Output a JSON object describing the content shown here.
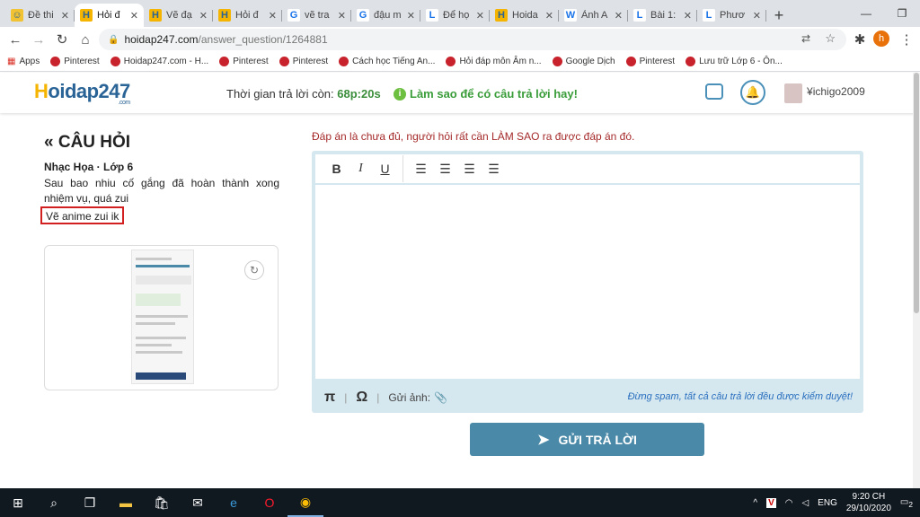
{
  "tabs": [
    {
      "label": "Đề thi",
      "fav": "☺",
      "favbg": "#f1c232",
      "active": false
    },
    {
      "label": "Hỏi đ",
      "fav": "H",
      "favbg": "#f4b400",
      "active": true
    },
    {
      "label": "Vẽ đạ",
      "fav": "H",
      "favbg": "#f4b400",
      "active": false
    },
    {
      "label": "Hỏi đ",
      "fav": "H",
      "favbg": "#f4b400",
      "active": false
    },
    {
      "label": "vẽ tra",
      "fav": "G",
      "favbg": "#ffffff",
      "active": false
    },
    {
      "label": "đậu m",
      "fav": "G",
      "favbg": "#ffffff",
      "active": false
    },
    {
      "label": "Để họ",
      "fav": "L",
      "favbg": "#ffffff",
      "active": false
    },
    {
      "label": "Hoida",
      "fav": "H",
      "favbg": "#f4b400",
      "active": false
    },
    {
      "label": "Ảnh A",
      "fav": "W",
      "favbg": "#ffffff",
      "active": false
    },
    {
      "label": "Bài 1:",
      "fav": "L",
      "favbg": "#ffffff",
      "active": false
    },
    {
      "label": "Phươ",
      "fav": "L",
      "favbg": "#ffffff",
      "active": false
    }
  ],
  "address": {
    "host": "hoidap247.com",
    "path": "/answer_question/1264881"
  },
  "profile_initial": "h",
  "bookmarks": [
    "Apps",
    "Pinterest",
    "Hoidap247.com - H...",
    "Pinterest",
    "Pinterest",
    "Cách học Tiếng An...",
    "Hỏi đáp môn Âm n...",
    "Google Dịch",
    "Pinterest",
    "Lưu trữ Lớp 6 - Ôn..."
  ],
  "header": {
    "logo_main": "oidap247",
    "logo_first": "H",
    "logo_com": ".com",
    "timer_label": "Thời gian trả lời còn:",
    "timer_value": "68p:20s",
    "tip": "Làm sao để có câu trả lời hay!",
    "username": "ichigo2009"
  },
  "question": {
    "title": "CÂU HỎI",
    "subject": "Nhạc Họa · Lớp 6",
    "body": "Sau bao nhiu cố gắng đã hoàn thành xong nhiệm vụ, quá zui",
    "highlight": "Vẽ anime zui ik"
  },
  "editor": {
    "notice": "Đáp án là chưa đủ, người hỏi rất cần LÀM SAO ra được đáp án đó.",
    "attach_label": "Gửi ảnh:",
    "spam_note": "Đừng spam, tất cả câu trả lời đều được kiểm duyệt!",
    "submit": "GỬI TRẢ LỜI"
  },
  "taskbar": {
    "lang": "ENG",
    "time": "9:20 CH",
    "date": "29/10/2020",
    "notif": "2"
  }
}
